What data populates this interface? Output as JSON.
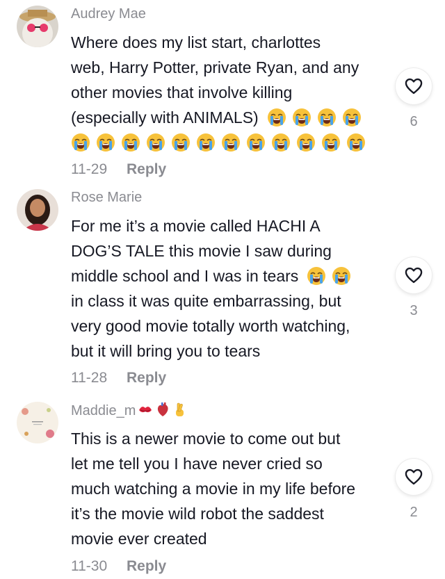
{
  "comments": [
    {
      "username": "Audrey Mae",
      "lines": [
        "Where does my list start, charlottes",
        "web, Harry Potter, private Ryan, and any",
        "other movies that involve killing",
        "(especially with ANIMALS)"
      ],
      "emoji_name": "loudly-crying-face",
      "date": "11-29",
      "reply_label": "Reply",
      "likes": "6"
    },
    {
      "username": "Rose Marie",
      "lines": [
        "For me it’s a movie called HACHI A",
        "DOG’S TALE this movie I saw during",
        "middle school and I was in tears",
        "in class it was quite embarrassing, but",
        "very good movie totally worth watching,",
        "but it will bring you to tears"
      ],
      "emoji_name": "loudly-crying-face",
      "date": "11-28",
      "reply_label": "Reply",
      "likes": "3"
    },
    {
      "username": "Maddie_m",
      "username_emojis": [
        "kiss-mark",
        "anatomical-heart",
        "crossed-fingers"
      ],
      "lines": [
        "This is a newer movie to come out but",
        "let me tell you I have never cried so",
        "much watching a movie in my life before",
        "it’s the movie wild robot the saddest",
        "movie ever created"
      ],
      "date": "11-30",
      "reply_label": "Reply",
      "likes": "2"
    }
  ],
  "colors": {
    "text": "#161823",
    "muted": "#8a8b91",
    "emoji_yellow": "#f7c23b",
    "tears_blue": "#4aa3e8"
  }
}
